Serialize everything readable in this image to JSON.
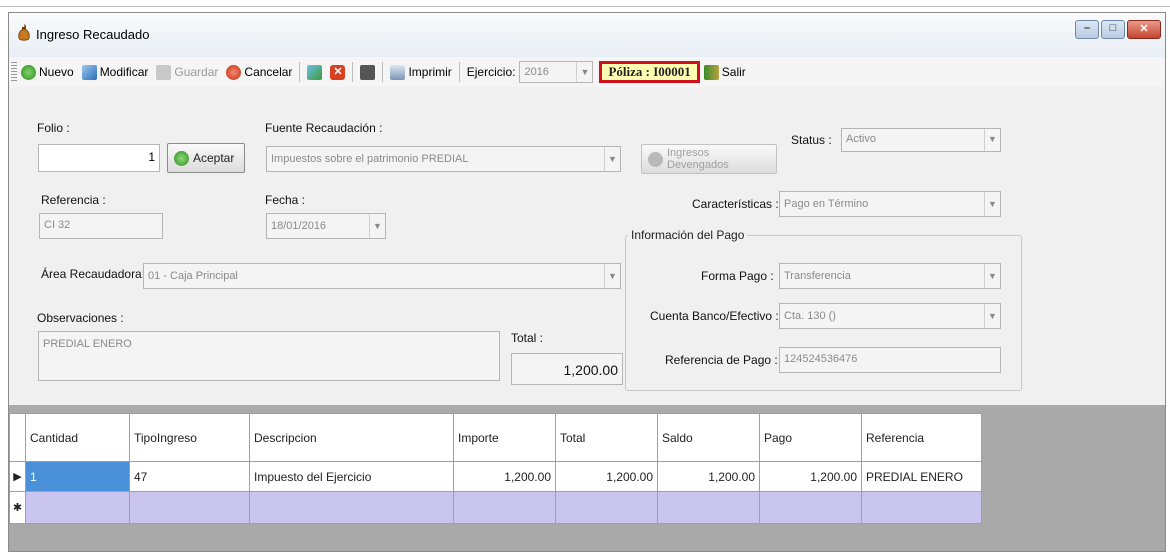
{
  "window": {
    "title": "Ingreso Recaudado",
    "buttons": {
      "minimize": "–",
      "maximize": "□",
      "close": "✕"
    }
  },
  "toolbar": {
    "nuevo": "Nuevo",
    "modificar": "Modificar",
    "guardar": "Guardar",
    "cancelar": "Cancelar",
    "imprimir": "Imprimir",
    "ejercicio_label": "Ejercicio:",
    "ejercicio_value": "2016",
    "poliza": "Póliza : I00001",
    "salir": "Salir"
  },
  "form": {
    "folio_label": "Folio :",
    "folio_value": "1",
    "aceptar": "Aceptar",
    "fuente_label": "Fuente Recaudación :",
    "fuente_value": "Impuestos sobre el patrimonio PREDIAL",
    "ingresos_devengados": "Ingresos Devengados",
    "status_label": "Status :",
    "status_value": "Activo",
    "referencia_label": "Referencia :",
    "referencia_value": "CI 32",
    "fecha_label": "Fecha :",
    "fecha_value": "18/01/2016",
    "caracteristicas_label": "Características :",
    "caracteristicas_value": "Pago en Término",
    "area_label": "Área Recaudadora:",
    "area_value": "01 - Caja Principal",
    "observaciones_label": "Observaciones :",
    "observaciones_value": "PREDIAL ENERO",
    "total_label": "Total :",
    "total_value": "1,200.00"
  },
  "pago": {
    "group_title": "Información del Pago",
    "forma_label": "Forma Pago :",
    "forma_value": "Transferencia",
    "cuenta_label": "Cuenta Banco/Efectivo :",
    "cuenta_value": "Cta. 130 ()",
    "referencia_label": "Referencia de Pago :",
    "referencia_value": "124524536476"
  },
  "grid": {
    "headers": [
      "Cantidad",
      "TipoIngreso",
      "Descripcion",
      "Importe",
      "Total",
      "Saldo",
      "Pago",
      "Referencia"
    ],
    "rows": [
      [
        "1",
        "47",
        "Impuesto del Ejercicio",
        "1,200.00",
        "1,200.00",
        "1,200.00",
        "1,200.00",
        "PREDIAL ENERO"
      ]
    ],
    "current_row_marker": "▶",
    "new_row_marker": "✱"
  },
  "colors": {
    "poliza_border": "#d0101a",
    "poliza_bg": "#ffffb4",
    "selected_cell": "#4a90d9",
    "new_row": "#c9c5ef"
  }
}
